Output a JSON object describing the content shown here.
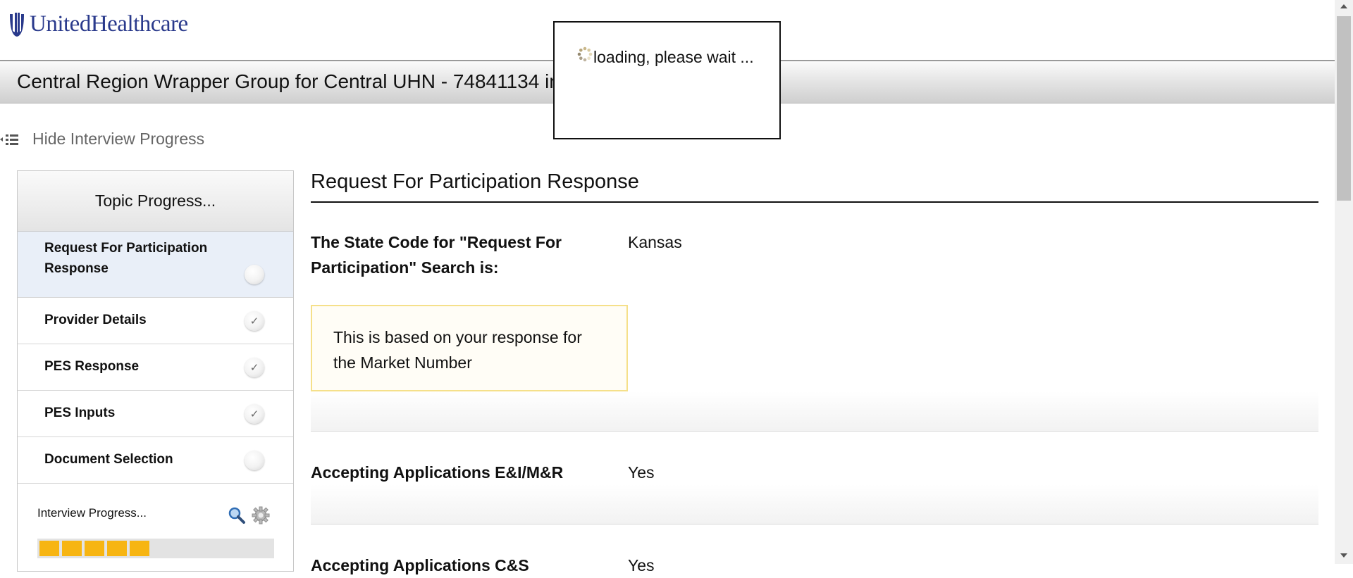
{
  "header": {
    "brand": "UnitedHealthcare",
    "title": "Central Region Wrapper Group for Central UHN - 74841134 in p"
  },
  "loading": {
    "text": "loading, please wait ..."
  },
  "toggle": {
    "label": "Hide Interview Progress",
    "icon": "hide-list-icon"
  },
  "sidebar": {
    "heading": "Topic Progress...",
    "topics": [
      {
        "label": "Request For Participation Response",
        "status": "current"
      },
      {
        "label": "Provider Details",
        "status": "complete",
        "check": "✓"
      },
      {
        "label": "PES Response",
        "status": "complete",
        "check": "✓"
      },
      {
        "label": "PES Inputs",
        "status": "complete",
        "check": "✓"
      },
      {
        "label": "Document Selection",
        "status": "pending"
      }
    ],
    "progress": {
      "label": "Interview Progress...",
      "filled_segments": 5,
      "icons": [
        "search-icon",
        "gear-icon"
      ]
    }
  },
  "main": {
    "title": "Request For Participation Response",
    "questions": [
      {
        "label": "The State Code for \"Request For Participation\" Search is:",
        "value": "Kansas"
      },
      {
        "label": "Accepting Applications E&I/M&R",
        "value": "Yes"
      },
      {
        "label": "Accepting Applications C&S",
        "value": "Yes"
      }
    ],
    "note": "This is based on your response for the Market Number"
  },
  "colors": {
    "brand": "#2a3a8c",
    "progress": "#f7b512",
    "active_topic_bg": "#e9eff8",
    "note_border": "#f5e08a"
  }
}
